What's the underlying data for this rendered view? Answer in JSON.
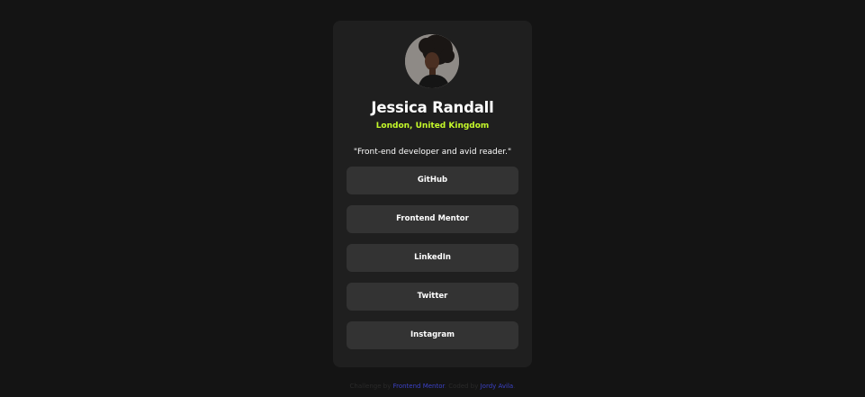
{
  "profile": {
    "name": "Jessica Randall",
    "location": "London, United Kingdom",
    "bio": "\"Front-end developer and avid reader.\""
  },
  "links": [
    {
      "label": "GitHub"
    },
    {
      "label": "Frontend Mentor"
    },
    {
      "label": "LinkedIn"
    },
    {
      "label": "Twitter"
    },
    {
      "label": "Instagram"
    }
  ],
  "attribution": {
    "prefix": "Challenge by",
    "challenge_link": "Frontend Mentor",
    "middle": ". Coded by",
    "author_link": "Jordy Avila",
    "suffix": "."
  },
  "colors": {
    "page_background": "#141414",
    "card_background": "#1f1f1f",
    "button_background": "#333333",
    "accent_green": "#c4f82a",
    "attribution_link": "#3b41c5"
  }
}
